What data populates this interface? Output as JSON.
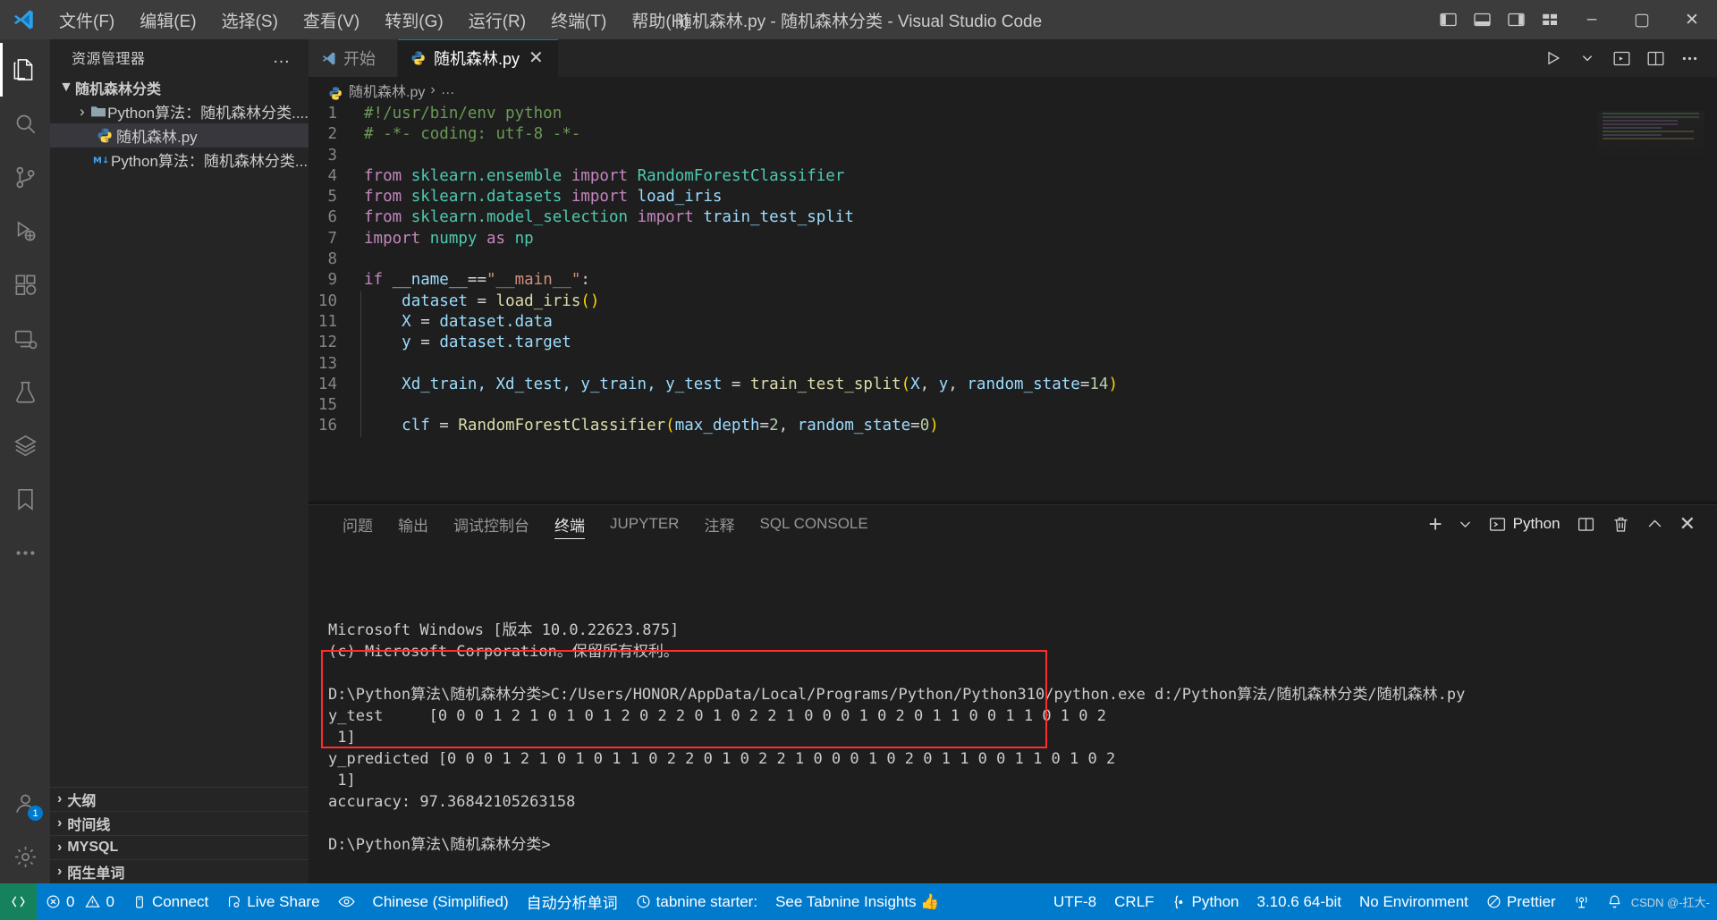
{
  "titlebar": {
    "logo_icon": "vscode-logo-icon",
    "menus": [
      "文件(F)",
      "编辑(E)",
      "选择(S)",
      "查看(V)",
      "转到(G)",
      "运行(R)",
      "终端(T)",
      "帮助(H)"
    ],
    "window_title": "随机森林.py - 随机森林分类 - Visual Studio Code",
    "layout_icons": [
      "panel-left-icon",
      "panel-bottom-icon",
      "panel-right-icon",
      "customize-layout-icon"
    ],
    "minimize": "–",
    "maximize": "▢",
    "close": "✕"
  },
  "activitybar": {
    "items": [
      {
        "name": "explorer",
        "icon": "files-icon",
        "active": true
      },
      {
        "name": "search",
        "icon": "search-icon",
        "active": false
      },
      {
        "name": "source-control",
        "icon": "source-control-icon",
        "active": false
      },
      {
        "name": "run-debug",
        "icon": "run-debug-icon",
        "active": false
      },
      {
        "name": "extensions",
        "icon": "extensions-icon",
        "active": false
      },
      {
        "name": "remote-explorer",
        "icon": "remote-explorer-icon",
        "active": false
      },
      {
        "name": "testing",
        "icon": "beaker-icon",
        "active": false
      },
      {
        "name": "database",
        "icon": "database-icon",
        "active": false
      },
      {
        "name": "bookmarks",
        "icon": "bookmark-icon",
        "active": false
      },
      {
        "name": "more",
        "icon": "ellipsis-icon",
        "active": false
      }
    ],
    "account_badge": "1",
    "account_icon": "account-icon",
    "settings_icon": "gear-icon"
  },
  "sidebar": {
    "title": "资源管理器",
    "more_actions": "…",
    "tree": [
      {
        "label": "随机森林分类",
        "level": 1,
        "chevron": "▼",
        "icon": "",
        "selected": false,
        "bold": true
      },
      {
        "label": "Python算法：随机森林分类....",
        "level": 2,
        "chevron": "›",
        "icon": "folder-icon",
        "selected": false,
        "bold": false
      },
      {
        "label": "随机森林.py",
        "level": 3,
        "chevron": "",
        "icon": "python-file-icon",
        "selected": true,
        "bold": false
      },
      {
        "label": "Python算法：随机森林分类....",
        "level": 3,
        "chevron": "",
        "icon": "markdown-file-icon",
        "selected": false,
        "bold": false
      }
    ],
    "sections": [
      {
        "label": "大纲",
        "chevron": "›"
      },
      {
        "label": "时间线",
        "chevron": "›"
      },
      {
        "label": "MYSQL",
        "chevron": "›"
      },
      {
        "label": "陌生单词",
        "chevron": "›"
      }
    ]
  },
  "tabs": {
    "items": [
      {
        "label": "开始",
        "icon": "vscode-icon",
        "active": false,
        "closable": false
      },
      {
        "label": "随机森林.py",
        "icon": "python-file-icon",
        "active": true,
        "closable": true,
        "close": "✕"
      }
    ],
    "actions": [
      "run-icon",
      "run-dropdown-icon",
      "split-run-icon",
      "split-editor-icon",
      "more-actions-icon"
    ]
  },
  "breadcrumb": {
    "icon": "python-file-icon",
    "file": "随机森林.py",
    "separator": "›",
    "symbol": "…"
  },
  "editor": {
    "lines": [
      {
        "n": 1,
        "tokens": [
          {
            "t": "#!/usr/bin/env python",
            "c": "cm"
          }
        ]
      },
      {
        "n": 2,
        "tokens": [
          {
            "t": "# -*- coding: utf-8 -*-",
            "c": "cm"
          }
        ]
      },
      {
        "n": 3,
        "tokens": []
      },
      {
        "n": 4,
        "tokens": [
          {
            "t": "from",
            "c": "kw"
          },
          {
            "t": " ",
            "c": "op"
          },
          {
            "t": "sklearn.ensemble",
            "c": "mod"
          },
          {
            "t": " ",
            "c": "op"
          },
          {
            "t": "import",
            "c": "kw"
          },
          {
            "t": " ",
            "c": "op"
          },
          {
            "t": "RandomForestClassifier",
            "c": "mod"
          }
        ]
      },
      {
        "n": 5,
        "tokens": [
          {
            "t": "from",
            "c": "kw"
          },
          {
            "t": " ",
            "c": "op"
          },
          {
            "t": "sklearn.datasets",
            "c": "mod"
          },
          {
            "t": " ",
            "c": "op"
          },
          {
            "t": "import",
            "c": "kw"
          },
          {
            "t": " ",
            "c": "op"
          },
          {
            "t": "load_iris",
            "c": "var"
          }
        ]
      },
      {
        "n": 6,
        "tokens": [
          {
            "t": "from",
            "c": "kw"
          },
          {
            "t": " ",
            "c": "op"
          },
          {
            "t": "sklearn.model_selection",
            "c": "mod"
          },
          {
            "t": " ",
            "c": "op"
          },
          {
            "t": "import",
            "c": "kw"
          },
          {
            "t": " ",
            "c": "op"
          },
          {
            "t": "train_test_split",
            "c": "var"
          }
        ]
      },
      {
        "n": 7,
        "tokens": [
          {
            "t": "import",
            "c": "kw"
          },
          {
            "t": " ",
            "c": "op"
          },
          {
            "t": "numpy",
            "c": "mod"
          },
          {
            "t": " ",
            "c": "op"
          },
          {
            "t": "as",
            "c": "kw"
          },
          {
            "t": " ",
            "c": "op"
          },
          {
            "t": "np",
            "c": "mod"
          }
        ]
      },
      {
        "n": 8,
        "tokens": []
      },
      {
        "n": 9,
        "tokens": [
          {
            "t": "if",
            "c": "kw"
          },
          {
            "t": " ",
            "c": "op"
          },
          {
            "t": "__name__",
            "c": "var"
          },
          {
            "t": "==",
            "c": "op"
          },
          {
            "t": "\"__main__\"",
            "c": "str"
          },
          {
            "t": ":",
            "c": "op"
          }
        ]
      },
      {
        "n": 10,
        "tokens": [
          {
            "t": "    ",
            "c": "op"
          },
          {
            "t": "dataset",
            "c": "var"
          },
          {
            "t": " = ",
            "c": "op"
          },
          {
            "t": "load_iris",
            "c": "fn"
          },
          {
            "t": "()",
            "c": "par"
          }
        ]
      },
      {
        "n": 11,
        "tokens": [
          {
            "t": "    ",
            "c": "op"
          },
          {
            "t": "X",
            "c": "var"
          },
          {
            "t": " = ",
            "c": "op"
          },
          {
            "t": "dataset.data",
            "c": "var"
          }
        ]
      },
      {
        "n": 12,
        "tokens": [
          {
            "t": "    ",
            "c": "op"
          },
          {
            "t": "y",
            "c": "var"
          },
          {
            "t": " = ",
            "c": "op"
          },
          {
            "t": "dataset.target",
            "c": "var"
          }
        ]
      },
      {
        "n": 13,
        "tokens": []
      },
      {
        "n": 14,
        "tokens": [
          {
            "t": "    ",
            "c": "op"
          },
          {
            "t": "Xd_train, Xd_test, y_train, y_test",
            "c": "var"
          },
          {
            "t": " = ",
            "c": "op"
          },
          {
            "t": "train_test_split",
            "c": "fn"
          },
          {
            "t": "(",
            "c": "par"
          },
          {
            "t": "X",
            "c": "var"
          },
          {
            "t": ", ",
            "c": "op"
          },
          {
            "t": "y",
            "c": "var"
          },
          {
            "t": ", ",
            "c": "op"
          },
          {
            "t": "random_state",
            "c": "var"
          },
          {
            "t": "=",
            "c": "op"
          },
          {
            "t": "14",
            "c": "num"
          },
          {
            "t": ")",
            "c": "par"
          }
        ]
      },
      {
        "n": 15,
        "tokens": []
      },
      {
        "n": 16,
        "tokens": [
          {
            "t": "    ",
            "c": "op"
          },
          {
            "t": "clf",
            "c": "var"
          },
          {
            "t": " = ",
            "c": "op"
          },
          {
            "t": "RandomForestClassifier",
            "c": "fn"
          },
          {
            "t": "(",
            "c": "par"
          },
          {
            "t": "max_depth",
            "c": "var"
          },
          {
            "t": "=",
            "c": "op"
          },
          {
            "t": "2",
            "c": "num"
          },
          {
            "t": ", ",
            "c": "op"
          },
          {
            "t": "random_state",
            "c": "var"
          },
          {
            "t": "=",
            "c": "op"
          },
          {
            "t": "0",
            "c": "num"
          },
          {
            "t": ")",
            "c": "par"
          }
        ]
      }
    ]
  },
  "panel": {
    "tabs": [
      {
        "label": "问题",
        "active": false
      },
      {
        "label": "输出",
        "active": false
      },
      {
        "label": "调试控制台",
        "active": false
      },
      {
        "label": "终端",
        "active": true
      },
      {
        "label": "JUPYTER",
        "active": false
      },
      {
        "label": "注释",
        "active": false
      },
      {
        "label": "SQL CONSOLE",
        "active": false
      }
    ],
    "actions": {
      "new_terminal": "+",
      "new_dropdown": "chevron-down-icon",
      "shell_icon": "terminal-icon",
      "shell_label": "Python",
      "split": "split-terminal-icon",
      "kill": "trash-icon",
      "maximize": "chevron-up-icon",
      "close": "✕"
    },
    "terminal_lines": [
      "Microsoft Windows [版本 10.0.22623.875]",
      "(c) Microsoft Corporation。保留所有权利。",
      "",
      "D:\\Python算法\\随机森林分类>C:/Users/HONOR/AppData/Local/Programs/Python/Python310/python.exe d:/Python算法/随机森林分类/随机森林.py",
      "y_test     [0 0 0 1 2 1 0 1 0 1 2 0 2 2 0 1 0 2 2 1 0 0 0 1 0 2 0 1 1 0 0 1 1 0 1 0 2",
      " 1]",
      "y_predicted [0 0 0 1 2 1 0 1 0 1 1 0 2 2 0 1 0 2 2 1 0 0 0 1 0 2 0 1 1 0 0 1 1 0 1 0 2",
      " 1]",
      "accuracy: 97.36842105263158",
      "",
      "D:\\Python算法\\随机森林分类>"
    ],
    "highlight_box_color": "#ff2d2d"
  },
  "statusbar": {
    "left": [
      {
        "label": "",
        "icon": "remote-icon",
        "kind": "remote"
      },
      {
        "label": "0",
        "icon": "error-icon",
        "label2": "0",
        "icon2": "warning-icon",
        "kind": "problems"
      },
      {
        "label": "Connect",
        "icon": "plug-icon",
        "kind": "item"
      },
      {
        "label": "Live Share",
        "icon": "live-share-icon",
        "kind": "item"
      },
      {
        "label": "",
        "icon": "eye-icon",
        "kind": "item"
      },
      {
        "label": "Chinese (Simplified)",
        "icon": "",
        "kind": "item"
      },
      {
        "label": "自动分析单词",
        "icon": "",
        "kind": "item"
      },
      {
        "label": "tabnine starter:",
        "icon": "tabnine-icon",
        "kind": "item"
      },
      {
        "label": "See Tabnine Insights 👍",
        "icon": "",
        "kind": "item"
      }
    ],
    "right": [
      {
        "label": "UTF-8"
      },
      {
        "label": "CRLF"
      },
      {
        "label": "Python",
        "icon": "braces-icon"
      },
      {
        "label": "3.10.6 64-bit"
      },
      {
        "label": "No Environment"
      },
      {
        "label": "Prettier",
        "icon": "prettier-icon"
      },
      {
        "label": "",
        "icon": "broadcast-icon"
      },
      {
        "label": "",
        "icon": "bell-icon"
      }
    ],
    "watermark": "CSDN @-扛大-"
  }
}
